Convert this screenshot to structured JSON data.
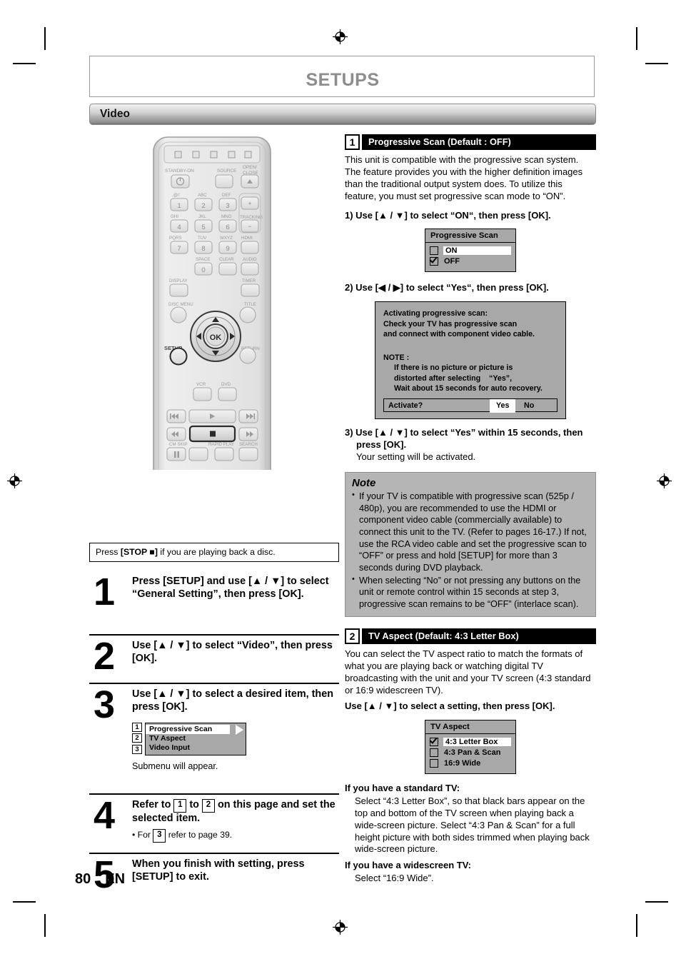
{
  "page": {
    "header_title": "SETUPS",
    "section_label": "Video",
    "footer_page": "80",
    "footer_lang": "EN"
  },
  "left": {
    "stop_note": {
      "prefix": "Press ",
      "key": "[STOP ■]",
      "suffix": " if you are playing back a disc."
    },
    "steps": [
      {
        "num": "1",
        "text": "Press [SETUP] and use [▲ / ▼] to select “General Setting”, then press [OK]."
      },
      {
        "num": "2",
        "text": "Use [▲ / ▼] to select “Video”, then press [OK]."
      },
      {
        "num": "3",
        "text": "Use [▲ / ▼] to select a desired item, then press [OK].",
        "after": "Submenu will appear."
      },
      {
        "num": "4",
        "text_a": "Refer to ",
        "badge_a": "1",
        "text_b": " to ",
        "badge_b": "2",
        "text_c": " on this page and set the selected item.",
        "sub_a": "• For ",
        "sub_badge": "3",
        "sub_b": " refer to page 39."
      },
      {
        "num": "5",
        "text": "When you finish with setting, press [SETUP] to exit."
      }
    ],
    "video_menu": {
      "badges": [
        "1",
        "2",
        "3"
      ],
      "rows": [
        "Progressive Scan",
        "TV Aspect",
        "Video Input"
      ],
      "selected_index": 0,
      "arrow": "right-arrow"
    },
    "remote": {
      "labels": {
        "standby": "STANDBY-ON",
        "source": "SOURCE",
        "open_close_1": "OPEN/",
        "open_close_2": "CLOSE",
        "k1_alt": ".@/:",
        "k2_alt": "ABC",
        "k3_alt": "DEF",
        "k4_alt": "GHI",
        "k5_alt": "JKL",
        "k6_alt": "MNO",
        "k7_alt": "PQRS",
        "k8_alt": "TUV",
        "k9_alt": "WXYZ",
        "k0_alt": "SPACE",
        "tracking": "TRACKING",
        "tracking_plus": "+",
        "tracking_minus": "–",
        "hdmi": "HDMI",
        "clear": "CLEAR",
        "audio": "AUDIO",
        "display": "DISPLAY",
        "timer": "TIMER",
        "disc_menu": "DISC MENU",
        "title": "TITLE",
        "setup": "SETUP",
        "return": "RETURN",
        "ok": "OK",
        "vcr": "VCR",
        "dvd": "DVD",
        "cm_skip": "CM SKIP",
        "rapid_play": "RAPID PLAY",
        "search": "SEARCH",
        "keys": [
          "1",
          "2",
          "3",
          "4",
          "5",
          "6",
          "7",
          "8",
          "9",
          "0"
        ]
      }
    }
  },
  "right": {
    "section1": {
      "num": "1",
      "title": "Progressive Scan (Default : OFF)",
      "body": "This unit is compatible with the progressive scan system. The feature provides you with the higher definition images than the traditional output system does. To utilize this feature, you must set progressive scan mode to “ON”.",
      "step1": "1) Use [▲ / ▼] to select “ON“, then press [OK].",
      "ps_menu": {
        "title": "Progressive Scan",
        "rows": [
          "ON",
          "OFF"
        ],
        "selected_index": 0,
        "checked_index": 1
      },
      "step2": "2) Use [◀ / ▶] to select “Yes“, then press [OK].",
      "dialog": {
        "line1": "Activating progressive scan:",
        "line2": "Check your TV has progressive scan",
        "line3": "and connect with component video cable.",
        "note_label": "NOTE :",
        "note1": "If there is no picture or picture is",
        "note2": "distorted after selecting    “Yes”,",
        "note3": "Wait about 15 seconds for auto recovery.",
        "prompt": "Activate?",
        "yes": "Yes",
        "no": "No"
      },
      "step3a": "3) Use [▲ / ▼] to select “Yes” within 15 seconds, then",
      "step3b": "press [OK].",
      "step3c": "Your setting will be activated."
    },
    "note": {
      "title": "Note",
      "items": [
        "If your TV is compatible with progressive scan (525p / 480p), you are recommended to use the HDMI or component video cable (commercially available) to connect this unit to the TV. (Refer to pages 16-17.) If not, use the RCA video cable and set the progressive scan to “OFF” or press and hold [SETUP] for more than 3 seconds during DVD playback.",
        "When selecting “No” or not pressing any buttons on the unit or remote control within 15 seconds at step 3, progressive scan remains to be “OFF” (interlace scan)."
      ]
    },
    "section2": {
      "num": "2",
      "title": "TV Aspect (Default: 4:3 Letter Box)",
      "body": "You can select the TV aspect ratio to match the formats of what you are playing back or watching digital TV broadcasting with the unit and your TV screen (4:3 standard or 16:9 widescreen TV).",
      "instruction": "Use [▲ / ▼] to select a setting, then press [OK].",
      "tv_menu": {
        "title": "TV Aspect",
        "rows": [
          "4:3 Letter Box",
          "4:3 Pan & Scan",
          "16:9 Wide"
        ],
        "selected_index": 0,
        "checked_index": 0
      },
      "standard_heading": "If you have a standard TV:",
      "standard_body": "Select “4:3 Letter Box”, so that black bars appear on the top and bottom of the TV screen when playing back a wide-screen picture. Select “4:3 Pan & Scan” for a full height picture with both sides trimmed when playing back wide-screen picture.",
      "wide_heading": "If you have a widescreen TV:",
      "wide_body": "Select “16:9 Wide”."
    }
  }
}
